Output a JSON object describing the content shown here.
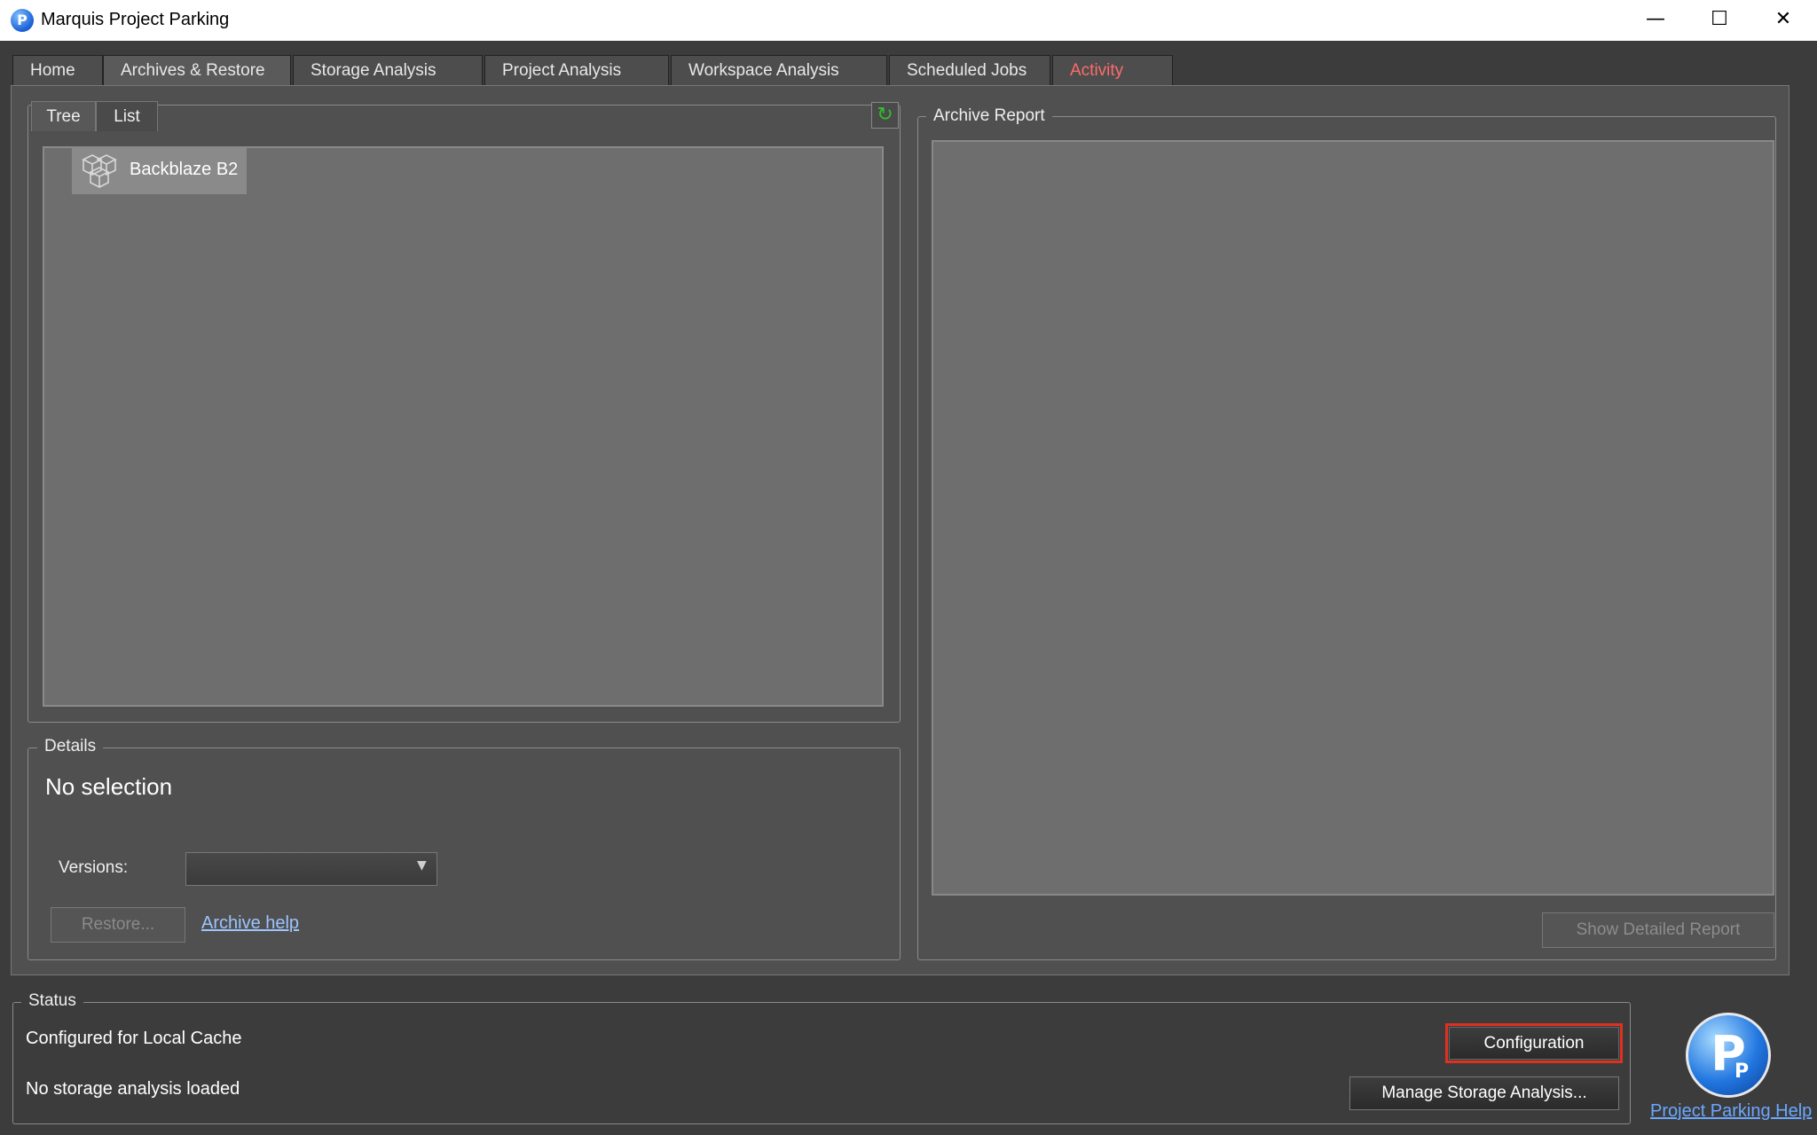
{
  "window": {
    "title": "Marquis Project Parking",
    "controls": {
      "minimize": "—",
      "maximize": "☐",
      "close": "✕"
    }
  },
  "tabs": [
    {
      "label": "Home"
    },
    {
      "label": "Archives & Restore",
      "active": true
    },
    {
      "label": "Storage Analysis"
    },
    {
      "label": "Project Analysis"
    },
    {
      "label": "Workspace Analysis"
    },
    {
      "label": "Scheduled Jobs"
    },
    {
      "label": "Activity",
      "color": "#ff6b6b"
    }
  ],
  "browser": {
    "subtabs": [
      {
        "label": "Tree",
        "active": true
      },
      {
        "label": "List"
      }
    ],
    "refresh_icon": "refresh-icon",
    "tree_items": [
      {
        "label": "Backblaze B2",
        "icon": "storage-cube-icon"
      }
    ]
  },
  "details": {
    "legend": "Details",
    "selection": "No selection",
    "versions_label": "Versions:",
    "versions_value": "",
    "restore_label": "Restore...",
    "help_link": "Archive help"
  },
  "report": {
    "legend": "Archive Report",
    "show_detailed_label": "Show Detailed Report"
  },
  "status": {
    "legend": "Status",
    "line1": "Configured for Local Cache",
    "line2": "No storage analysis loaded",
    "configuration_label": "Configuration",
    "manage_label": "Manage Storage Analysis...",
    "help_link": "Project Parking Help",
    "highlight_color": "#e03020"
  }
}
